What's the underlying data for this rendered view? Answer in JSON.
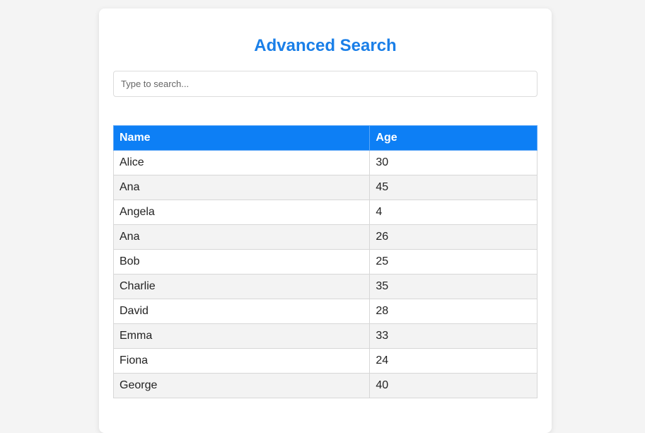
{
  "title": "Advanced Search",
  "search": {
    "placeholder": "Type to search...",
    "value": ""
  },
  "table": {
    "columns": [
      "Name",
      "Age"
    ],
    "rows": [
      {
        "name": "Alice",
        "age": "30"
      },
      {
        "name": "Ana",
        "age": "45"
      },
      {
        "name": "Angela",
        "age": "4"
      },
      {
        "name": "Ana",
        "age": "26"
      },
      {
        "name": "Bob",
        "age": "25"
      },
      {
        "name": "Charlie",
        "age": "35"
      },
      {
        "name": "David",
        "age": "28"
      },
      {
        "name": "Emma",
        "age": "33"
      },
      {
        "name": "Fiona",
        "age": "24"
      },
      {
        "name": "George",
        "age": "40"
      }
    ]
  },
  "colors": {
    "accent": "#1a7fe8",
    "header_bg": "#0d7ff5"
  }
}
